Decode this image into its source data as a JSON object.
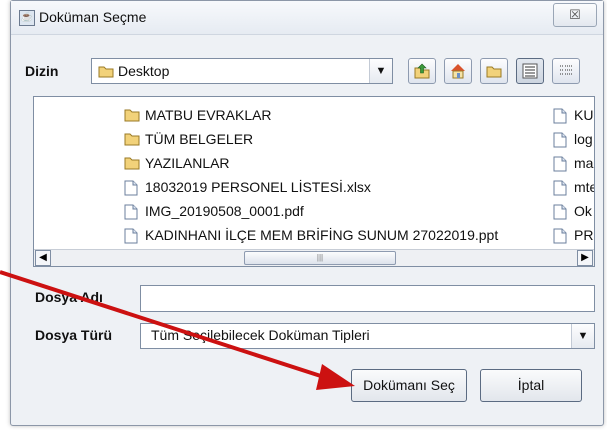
{
  "window": {
    "title": "Doküman Seçme",
    "close": "☒"
  },
  "toolbar": {
    "dir_label": "Dizin",
    "dir_value": "Desktop",
    "buttons": [
      "up-folder",
      "home",
      "new-folder",
      "list-view",
      "details-view"
    ]
  },
  "files": {
    "left": [
      {
        "name": "MATBU EVRAKLAR",
        "type": "folder"
      },
      {
        "name": "TÜM BELGELER",
        "type": "folder"
      },
      {
        "name": "YAZILANLAR",
        "type": "folder"
      },
      {
        "name": "18032019 PERSONEL LİSTESİ.xlsx",
        "type": "file"
      },
      {
        "name": "IMG_20190508_0001.pdf",
        "type": "file"
      },
      {
        "name": "KADINHANI İLÇE MEM BRİFİNG SUNUM 27022019.ppt",
        "type": "file"
      }
    ],
    "right": [
      {
        "name": "KU",
        "type": "file"
      },
      {
        "name": "log",
        "type": "file"
      },
      {
        "name": "ma",
        "type": "file"
      },
      {
        "name": "mte",
        "type": "file"
      },
      {
        "name": "Ok",
        "type": "file"
      },
      {
        "name": "PR",
        "type": "file"
      }
    ],
    "scroll_thumb": "|||"
  },
  "form": {
    "filename_label": "Dosya Adı",
    "filename_value": "",
    "filetype_label": "Dosya Türü",
    "filetype_value": "Tüm Seçilebilecek Doküman Tipleri"
  },
  "buttons": {
    "select": "Dokümanı Seç",
    "cancel": "İptal"
  },
  "colors": {
    "arrow": "#cc1111",
    "window_bg": "#eef1f5",
    "folder": "#e8c25a"
  }
}
